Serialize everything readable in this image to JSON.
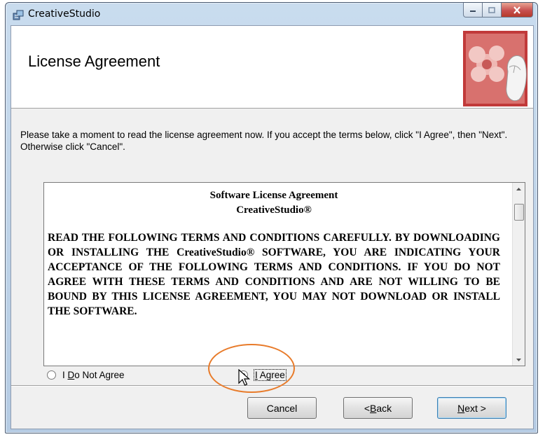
{
  "window": {
    "title": "CreativeStudio"
  },
  "header": {
    "title": "License Agreement"
  },
  "instruction": "Please take a moment to read the license agreement now. If you accept the terms below, click \"I Agree\", then \"Next\". Otherwise click \"Cancel\".",
  "license": {
    "title_line1": "Software License Agreement",
    "title_line2": "CreativeStudio®",
    "body": "READ THE FOLLOWING TERMS AND CONDITIONS CAREFULLY. BY DOWNLOADING OR INSTALLING THE CreativeStudio® SOFTWARE, YOU ARE INDICATING YOUR ACCEPTANCE OF THE FOLLOWING TERMS AND CONDITIONS. IF YOU DO NOT AGREE WITH THESE TERMS AND CONDITIONS AND ARE NOT WILLING TO BE BOUND BY THIS LICENSE AGREEMENT, YOU MAY NOT DOWNLOAD OR INSTALL THE SOFTWARE."
  },
  "options": {
    "do_not_agree": {
      "pre": "I ",
      "accel": "D",
      "post": "o Not Agree",
      "selected": false
    },
    "agree": {
      "pre": "",
      "accel": "I",
      "post": " Agree",
      "selected": true
    }
  },
  "buttons": {
    "cancel": "Cancel",
    "back": {
      "pre": "< ",
      "accel": "B",
      "post": "ack"
    },
    "next": {
      "accel": "N",
      "post": "ext >"
    }
  },
  "colors": {
    "highlight_ring": "#e87b2a",
    "close_button": "#c75050",
    "default_button_border": "#3c7fb1"
  },
  "icons": [
    "installer-app-icon",
    "minimize-icon",
    "maximize-icon",
    "close-icon",
    "header-mouse-graphic",
    "scroll-up-arrow-icon",
    "scroll-down-arrow-icon",
    "pointer-cursor-icon"
  ]
}
